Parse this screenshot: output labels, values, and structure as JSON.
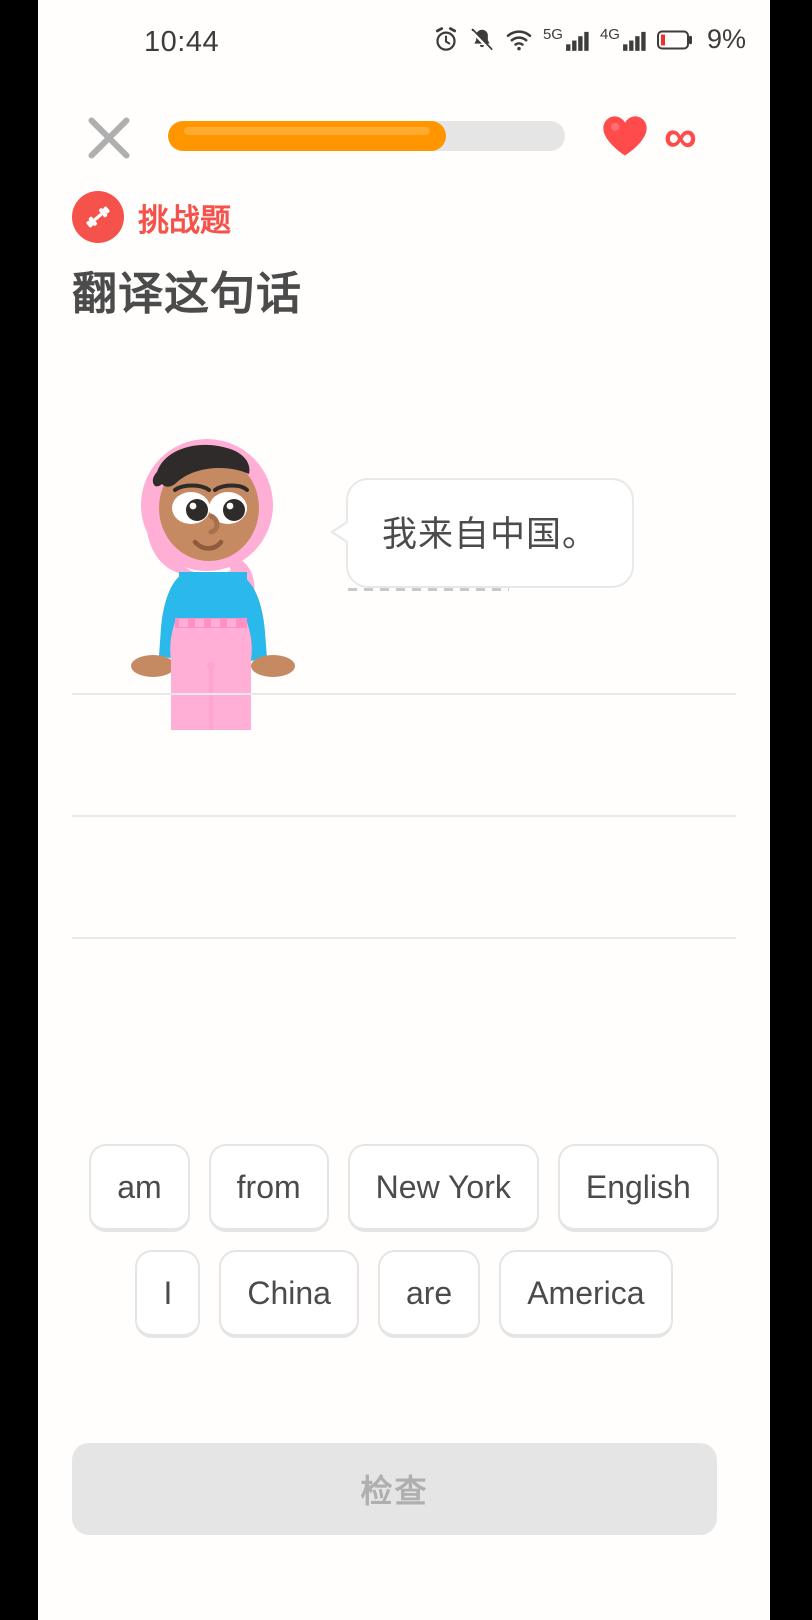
{
  "status_bar": {
    "time": "10:44",
    "battery_percent": "9%",
    "icons": [
      "alarm-icon",
      "bell-muted-icon",
      "wifi-icon",
      "signal-5g-icon",
      "signal-4g-icon",
      "battery-low-icon"
    ],
    "signal_labels": {
      "sim1": "5G",
      "sim2": "4G"
    }
  },
  "top_bar": {
    "close_label": "×",
    "progress_percent": 70,
    "hearts_icon": "heart-icon",
    "hearts_value": "∞",
    "heart_color": "#ff4b4b",
    "progress_color": "#ff9600",
    "progress_track_color": "#e5e5e5"
  },
  "exercise": {
    "badge_icon": "dumbbell-icon",
    "badge_label": "挑战题",
    "badge_color": "#f4524a",
    "title": "翻译这句话",
    "prompt_sentence": "我来自中国。",
    "character": "female-avatar-pink-hijab",
    "answer_slot_count": 3
  },
  "word_bank": {
    "rows": [
      [
        {
          "label": "am"
        },
        {
          "label": "from"
        },
        {
          "label": "New York"
        },
        {
          "label": "English"
        }
      ],
      [
        {
          "label": "I"
        },
        {
          "label": "China"
        },
        {
          "label": "are"
        },
        {
          "label": "America"
        }
      ]
    ]
  },
  "footer": {
    "check_label": "检查",
    "check_enabled": false
  }
}
